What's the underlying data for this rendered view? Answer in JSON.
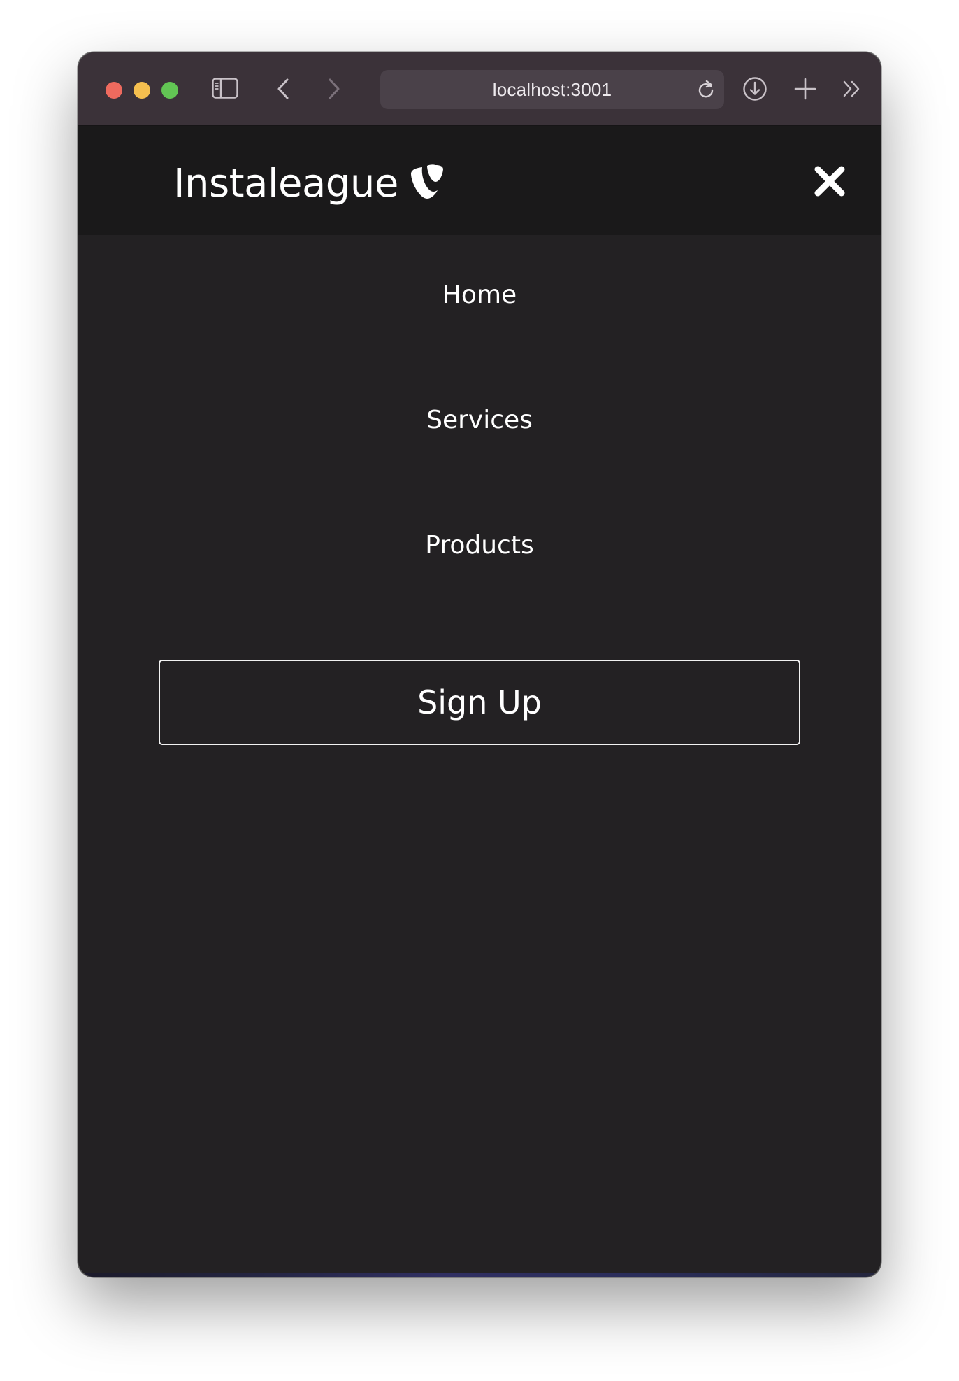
{
  "browser": {
    "url": "localhost:3001",
    "traffic_lights": [
      "close",
      "minimize",
      "zoom"
    ],
    "icons": {
      "sidebar": "sidebar-icon",
      "back": "chevron-left-icon",
      "forward": "chevron-right-icon",
      "reload": "reload-icon",
      "download": "download-icon",
      "new_tab": "plus-icon",
      "more": "double-chevron-right-icon"
    }
  },
  "navbar": {
    "brand": "Instaleague",
    "logo_icon": "typo3-logo-icon",
    "close_icon": "close-icon"
  },
  "menu": {
    "items": [
      {
        "label": "Home"
      },
      {
        "label": "Services"
      },
      {
        "label": "Products"
      }
    ],
    "signup_label": "Sign Up"
  },
  "colors": {
    "page_background": "#232123",
    "navbar_background": "#1a191a",
    "titlebar_background": "#3b3239",
    "text": "#ffffff"
  }
}
